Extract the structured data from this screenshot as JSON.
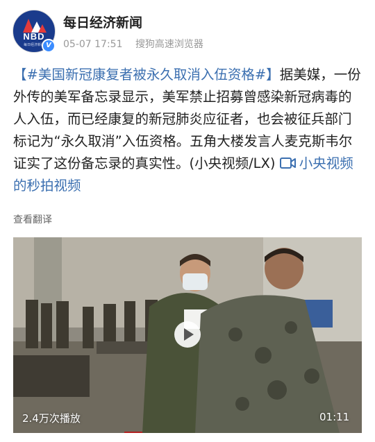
{
  "account": {
    "name": "每日经济新闻",
    "avatar_text": "NBD",
    "avatar_subtext": "每日经济新闻",
    "verified_icon": "v-verified-icon",
    "time": "05-07 17:51",
    "source": "搜狗高速浏览器"
  },
  "post": {
    "hashtag": "【#美国新冠康复者被永久取消入伍资格#】",
    "text": "据美媒，一份外传的美军备忘录显示，美军禁止招募曾感染新冠病毒的人入伍，而已经康复的新冠肺炎应征者，也会被征兵部门标记为“永久取消”入伍资格。五角大楼发言人麦克斯韦尔证实了这份备忘录的真实性。(小央视频/LX) ",
    "video_link_icon": "video-camera-icon",
    "video_link": "小央视频的秒拍视频",
    "translate": "查看翻译"
  },
  "video": {
    "views": "2.4万次播放",
    "duration": "01:11",
    "play_icon": "play-icon"
  },
  "colors": {
    "link": "#3b6fb0",
    "meta": "#999999",
    "brand": "#1a3b8c"
  }
}
